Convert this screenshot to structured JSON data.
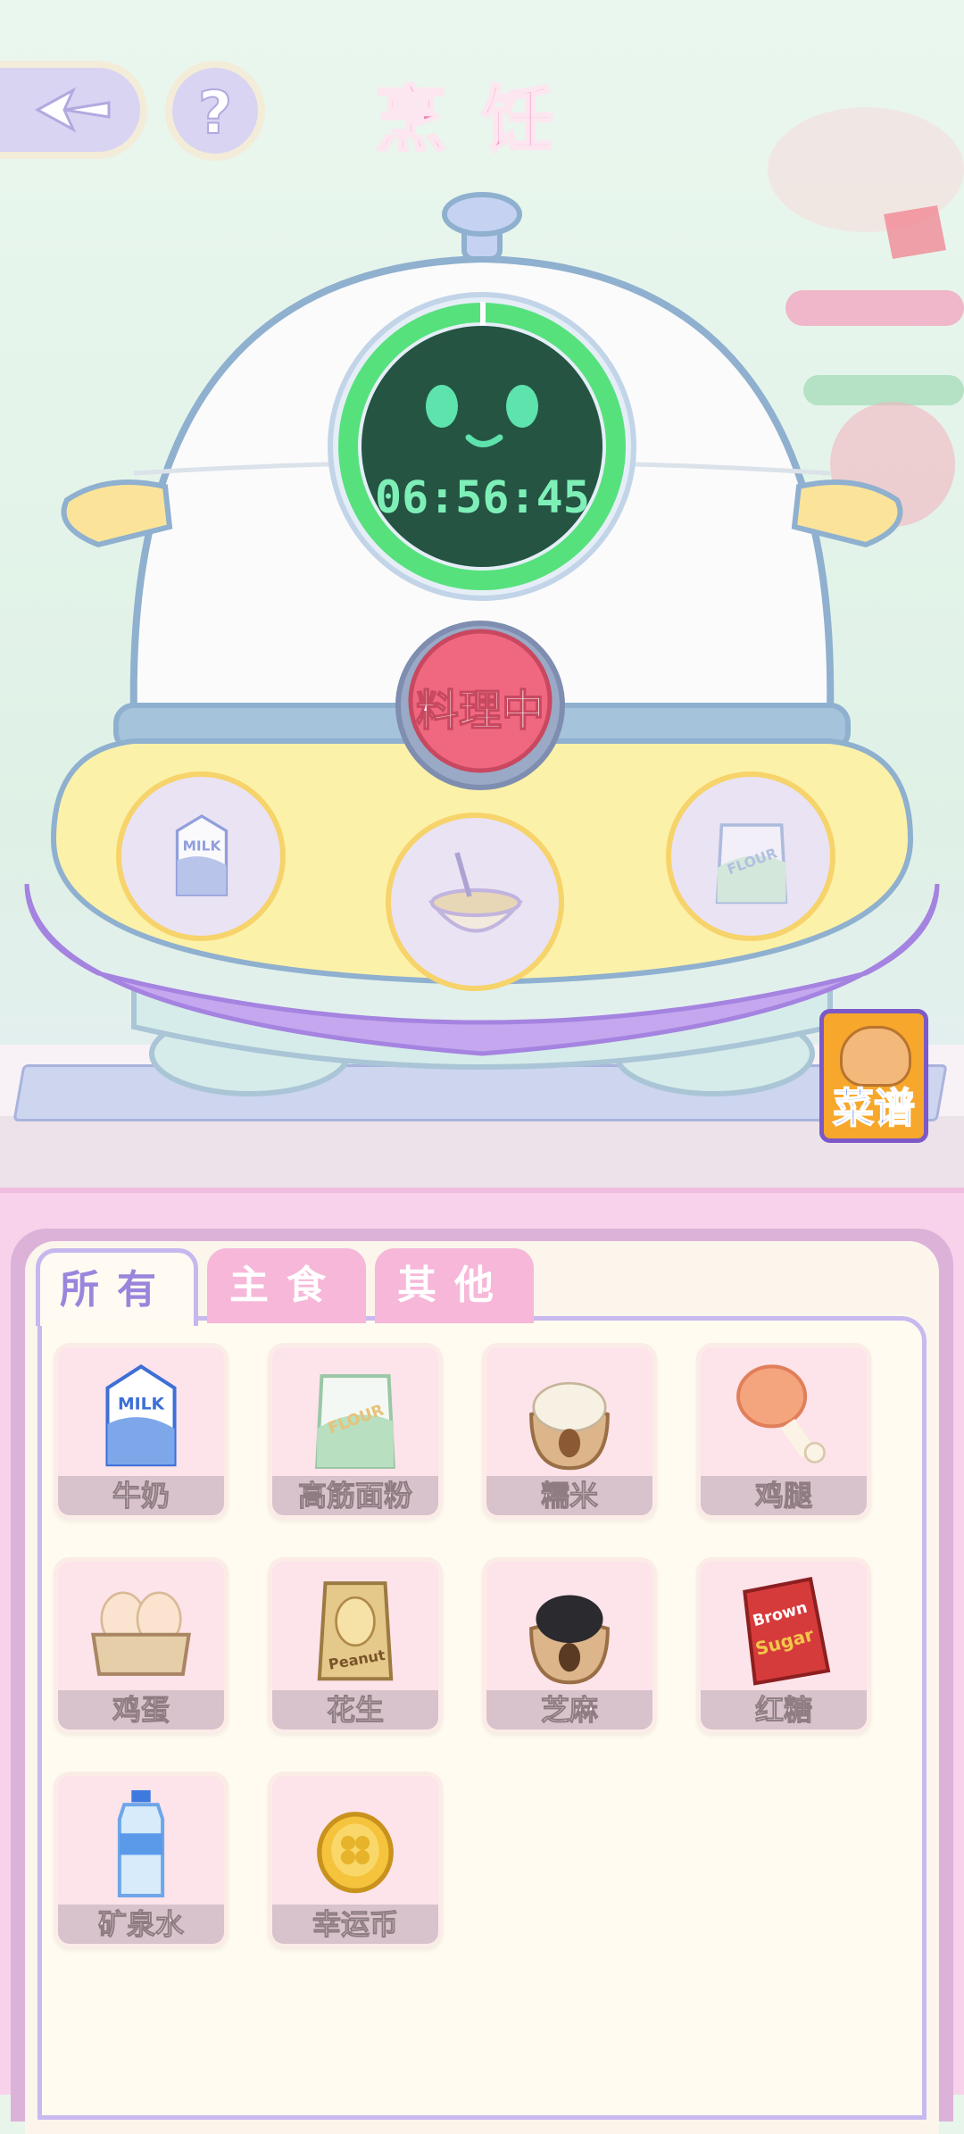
{
  "header": {
    "title": "烹饪",
    "help_label": "?"
  },
  "cooker": {
    "timer": "06:56:45",
    "status_button": "料理中",
    "timer_progress": 0.99
  },
  "recipe_book": {
    "label": "菜谱"
  },
  "tabs": [
    {
      "label": "所有",
      "active": true
    },
    {
      "label": "主食",
      "active": false
    },
    {
      "label": "其他",
      "active": false
    }
  ],
  "slots": [
    {
      "icon": "milk-carton-icon"
    },
    {
      "icon": "mixing-bowl-icon"
    },
    {
      "icon": "flour-bag-icon"
    }
  ],
  "items": [
    {
      "name": "牛奶",
      "icon": "milk-carton-icon"
    },
    {
      "name": "高筋面粉",
      "icon": "flour-bag-icon"
    },
    {
      "name": "糯米",
      "icon": "rice-sack-icon"
    },
    {
      "name": "鸡腿",
      "icon": "chicken-leg-icon"
    },
    {
      "name": "鸡蛋",
      "icon": "egg-carton-icon"
    },
    {
      "name": "花生",
      "icon": "peanut-bag-icon"
    },
    {
      "name": "芝麻",
      "icon": "sesame-sack-icon"
    },
    {
      "name": "红糖",
      "icon": "brown-sugar-bag-icon"
    },
    {
      "name": "矿泉水",
      "icon": "water-bottle-icon"
    },
    {
      "name": "幸运币",
      "icon": "lucky-coin-icon"
    }
  ],
  "image_text": {
    "milk": "MILK",
    "flour": "FLOUR",
    "peanut": "Peanut",
    "brown": "Brown",
    "sugar": "Sugar"
  }
}
